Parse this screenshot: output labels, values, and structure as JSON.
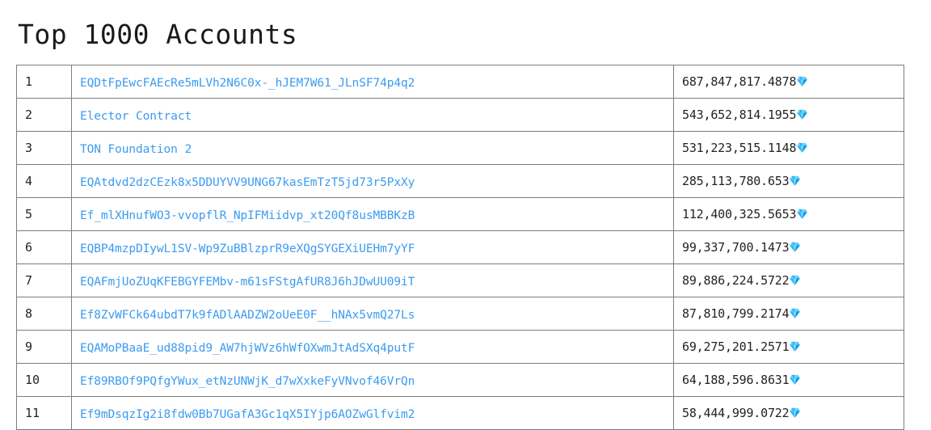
{
  "page": {
    "title": "Top 1000 Accounts"
  },
  "table": {
    "currency_icon": "gem-icon",
    "link_color": "#3c9bf0",
    "border_color": "#7d7d7d",
    "text_color": "#232323",
    "rows": [
      {
        "rank": "1",
        "address": "EQDtFpEwcFAEcRe5mLVh2N6C0x-_hJEM7W61_JLnSF74p4q2",
        "balance": "687,847,817.4878"
      },
      {
        "rank": "2",
        "address": "Elector Contract",
        "balance": "543,652,814.1955"
      },
      {
        "rank": "3",
        "address": "TON Foundation 2",
        "balance": "531,223,515.1148"
      },
      {
        "rank": "4",
        "address": "EQAtdvd2dzCEzk8x5DDUYVV9UNG67kasEmTzT5jd73r5PxXy",
        "balance": "285,113,780.653"
      },
      {
        "rank": "5",
        "address": "Ef_mlXHnufWO3-vvopflR_NpIFMiidvp_xt20Qf8usMBBKzB",
        "balance": "112,400,325.5653"
      },
      {
        "rank": "6",
        "address": "EQBP4mzpDIywL1SV-Wp9ZuBBlzprR9eXQgSYGEXiUEHm7yYF",
        "balance": "99,337,700.1473"
      },
      {
        "rank": "7",
        "address": "EQAFmjUoZUqKFEBGYFEMbv-m61sFStgAfUR8J6hJDwUU09iT",
        "balance": "89,886,224.5722"
      },
      {
        "rank": "8",
        "address": "Ef8ZvWFCk64ubdT7k9fADlAADZW2oUeE0F__hNAx5vmQ27Ls",
        "balance": "87,810,799.2174"
      },
      {
        "rank": "9",
        "address": "EQAMoPBaaE_ud88pid9_AW7hjWVz6hWfOXwmJtAdSXq4putF",
        "balance": "69,275,201.2571"
      },
      {
        "rank": "10",
        "address": "Ef89RBOf9PQfgYWux_etNzUNWjK_d7wXxkeFyVNvof46VrQn",
        "balance": "64,188,596.8631"
      },
      {
        "rank": "11",
        "address": "Ef9mDsqzIg2i8fdw0Bb7UGafA3Gc1qX5IYjp6AOZwGlfvim2",
        "balance": "58,444,999.0722"
      }
    ]
  }
}
